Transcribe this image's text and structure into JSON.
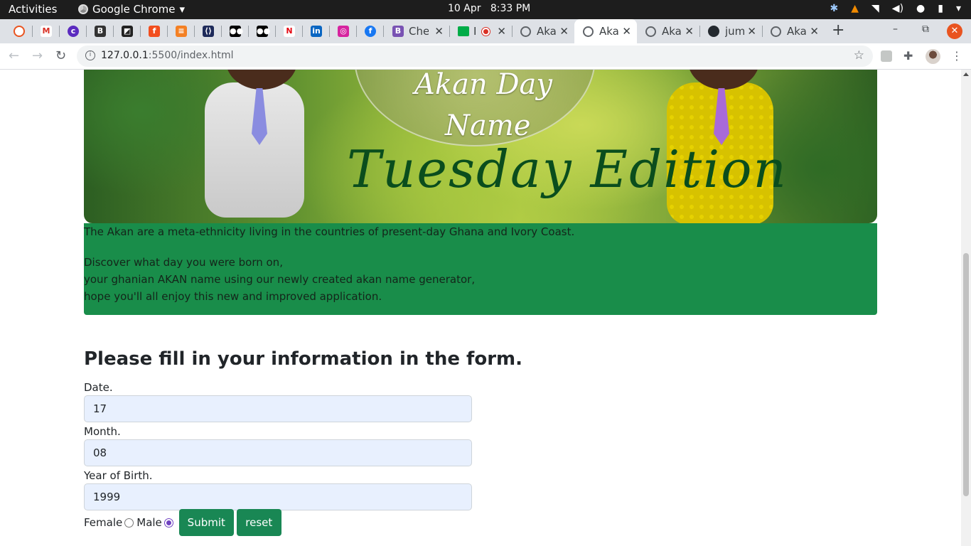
{
  "os_bar": {
    "activities": "Activities",
    "app_name": "Google Chrome",
    "date": "10 Apr",
    "time": "8:33 PM"
  },
  "tabs": [
    {
      "label": "Che"
    },
    {
      "label": "I"
    },
    {
      "label": "Aka"
    },
    {
      "label": "Aka"
    },
    {
      "label": "Aka"
    },
    {
      "label": "jum"
    },
    {
      "label": "Aka"
    }
  ],
  "toolbar": {
    "url_host": "127.0.0.1",
    "url_rest": ":5500/index.html"
  },
  "hero": {
    "logo_line1": "Akan Day",
    "logo_line2": "Name",
    "logo_line3": "Tuesday Edition"
  },
  "intro": {
    "paragraph1": "The Akan are a meta-ethnicity living in the countries of present-day Ghana and Ivory Coast.",
    "line1": "Discover what day you were born on,",
    "line2": "your ghanian AKAN name using our newly created akan name generator,",
    "line3": "hope you'll all enjoy this new and improved application."
  },
  "form": {
    "title": "Please fill in your information in the form.",
    "date_label": "Date.",
    "date_value": "17",
    "month_label": "Month.",
    "month_value": "08",
    "year_label": "Year of Birth.",
    "year_value": "1999",
    "female_label": "Female",
    "male_label": "Male",
    "selected_gender": "male",
    "submit_label": "Submit",
    "reset_label": "reset"
  },
  "colors": {
    "accent_green": "#198d4a",
    "button_green": "#198754",
    "input_fill": "#e8f0fe"
  }
}
